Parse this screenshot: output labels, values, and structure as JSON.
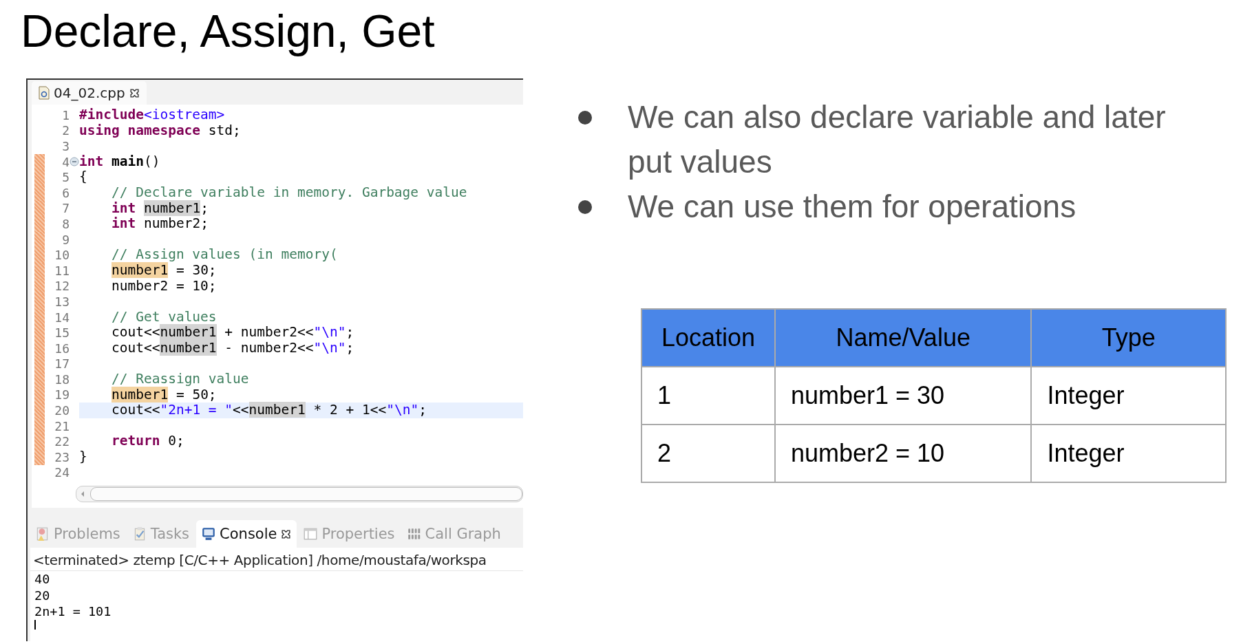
{
  "title": "Declare, Assign, Get",
  "editor": {
    "tab": {
      "label": "04_02.cpp",
      "selected": true
    },
    "lines": [
      {
        "number": "1",
        "changed": false,
        "fold": false,
        "current": false,
        "tokens": [
          {
            "text": "#include",
            "kind": "directive"
          },
          {
            "text": "<iostream>",
            "kind": "include"
          }
        ]
      },
      {
        "number": "2",
        "changed": false,
        "fold": false,
        "current": false,
        "tokens": [
          {
            "text": "using namespace",
            "kind": "keyword"
          },
          {
            "text": " std;",
            "kind": "plain"
          }
        ]
      },
      {
        "number": "3",
        "changed": false,
        "fold": false,
        "current": false
      },
      {
        "number": "4",
        "changed": true,
        "fold": true,
        "current": false,
        "tokens": [
          {
            "text": "int ",
            "kind": "keyword"
          },
          {
            "text": "main",
            "kind": "function"
          },
          {
            "text": "()",
            "kind": "plain"
          }
        ]
      },
      {
        "number": "5",
        "changed": true,
        "fold": false,
        "current": false,
        "tokens": [
          {
            "text": "{",
            "kind": "plain"
          }
        ]
      },
      {
        "number": "6",
        "changed": true,
        "fold": false,
        "current": false,
        "tokens": [
          {
            "text": "    // Declare variable in memory. Garbage value",
            "kind": "comment"
          }
        ]
      },
      {
        "number": "7",
        "changed": true,
        "fold": false,
        "current": false,
        "tokens": [
          {
            "text": "    int ",
            "kind": "keyword"
          },
          {
            "text": "number1",
            "kind": "read_mark"
          },
          {
            "text": ";",
            "kind": "plain"
          }
        ]
      },
      {
        "number": "8",
        "changed": true,
        "fold": false,
        "current": false,
        "tokens": [
          {
            "text": "    int",
            "kind": "keyword"
          },
          {
            "text": " number2;",
            "kind": "plain"
          }
        ]
      },
      {
        "number": "9",
        "changed": true,
        "fold": false,
        "current": false
      },
      {
        "number": "10",
        "changed": true,
        "fold": false,
        "current": false,
        "tokens": [
          {
            "text": "    // Assign values (in memory(",
            "kind": "comment"
          }
        ]
      },
      {
        "number": "11",
        "changed": true,
        "fold": false,
        "current": false,
        "tokens": [
          {
            "text": "    number1",
            "kind": "write_mark"
          },
          {
            "text": " = 30;",
            "kind": "plain"
          }
        ]
      },
      {
        "number": "12",
        "changed": true,
        "fold": false,
        "current": false,
        "tokens": [
          {
            "text": "    number2 = 10;",
            "kind": "plain"
          }
        ]
      },
      {
        "number": "13",
        "changed": true,
        "fold": false,
        "current": false
      },
      {
        "number": "14",
        "changed": true,
        "fold": false,
        "current": false,
        "tokens": [
          {
            "text": "    // Get values",
            "kind": "comment"
          }
        ]
      },
      {
        "number": "15",
        "changed": true,
        "fold": false,
        "current": false,
        "tokens": [
          {
            "text": "    cout<<",
            "kind": "plain"
          },
          {
            "text": "number1",
            "kind": "read_mark"
          },
          {
            "text": " + number2<<",
            "kind": "plain"
          },
          {
            "text": "\"\\n\"",
            "kind": "string"
          },
          {
            "text": ";",
            "kind": "plain"
          }
        ]
      },
      {
        "number": "16",
        "changed": true,
        "fold": false,
        "current": false,
        "tokens": [
          {
            "text": "    cout<<",
            "kind": "plain"
          },
          {
            "text": "number1",
            "kind": "read_mark"
          },
          {
            "text": " - number2<<",
            "kind": "plain"
          },
          {
            "text": "\"\\n\"",
            "kind": "string"
          },
          {
            "text": ";",
            "kind": "plain"
          }
        ]
      },
      {
        "number": "17",
        "changed": true,
        "fold": false,
        "current": false
      },
      {
        "number": "18",
        "changed": true,
        "fold": false,
        "current": false,
        "tokens": [
          {
            "text": "    // Reassign value",
            "kind": "comment"
          }
        ]
      },
      {
        "number": "19",
        "changed": true,
        "fold": false,
        "current": false,
        "tokens": [
          {
            "text": "    number1",
            "kind": "write_mark"
          },
          {
            "text": " = 50;",
            "kind": "plain"
          }
        ]
      },
      {
        "number": "20",
        "changed": true,
        "fold": false,
        "current": true,
        "tokens": [
          {
            "text": "    cout<<",
            "kind": "plain"
          },
          {
            "text": "\"2n+1 = \"",
            "kind": "string"
          },
          {
            "text": "<<",
            "kind": "plain"
          },
          {
            "text": "number1",
            "kind": "read_mark"
          },
          {
            "text": " * 2 + 1<<",
            "kind": "plain"
          },
          {
            "text": "\"\\n\"",
            "kind": "string"
          },
          {
            "text": ";",
            "kind": "plain"
          }
        ]
      },
      {
        "number": "21",
        "changed": true,
        "fold": false,
        "current": false
      },
      {
        "number": "22",
        "changed": true,
        "fold": false,
        "current": false,
        "tokens": [
          {
            "text": "    return",
            "kind": "keyword"
          },
          {
            "text": " 0;",
            "kind": "plain"
          }
        ]
      },
      {
        "number": "23",
        "changed": true,
        "fold": false,
        "current": false,
        "tokens": [
          {
            "text": "}",
            "kind": "plain"
          }
        ]
      },
      {
        "number": "24",
        "changed": false,
        "fold": false,
        "current": false
      }
    ]
  },
  "bottom_tabs": [
    {
      "label": "Problems",
      "kind": "problems",
      "selected": false
    },
    {
      "label": "Tasks",
      "kind": "tasks",
      "selected": false
    },
    {
      "label": "Console",
      "kind": "console",
      "selected": true
    },
    {
      "label": "Properties",
      "kind": "properties",
      "selected": false
    },
    {
      "label": "Call Graph",
      "kind": "callgraph",
      "selected": false
    }
  ],
  "console": {
    "header": "<terminated> ztemp [C/C++ Application] /home/moustafa/workspa",
    "output": [
      "40",
      "20",
      "2n+1 = 101"
    ]
  },
  "bullets": [
    "We can also declare variable and later put values",
    "We can use them for operations"
  ],
  "table": {
    "columns": [
      "Location",
      "Name/Value",
      "Type"
    ],
    "rows": [
      [
        "1",
        "number1 = 30",
        "Integer"
      ],
      [
        "2",
        "number2 = 10",
        "Integer"
      ]
    ]
  }
}
